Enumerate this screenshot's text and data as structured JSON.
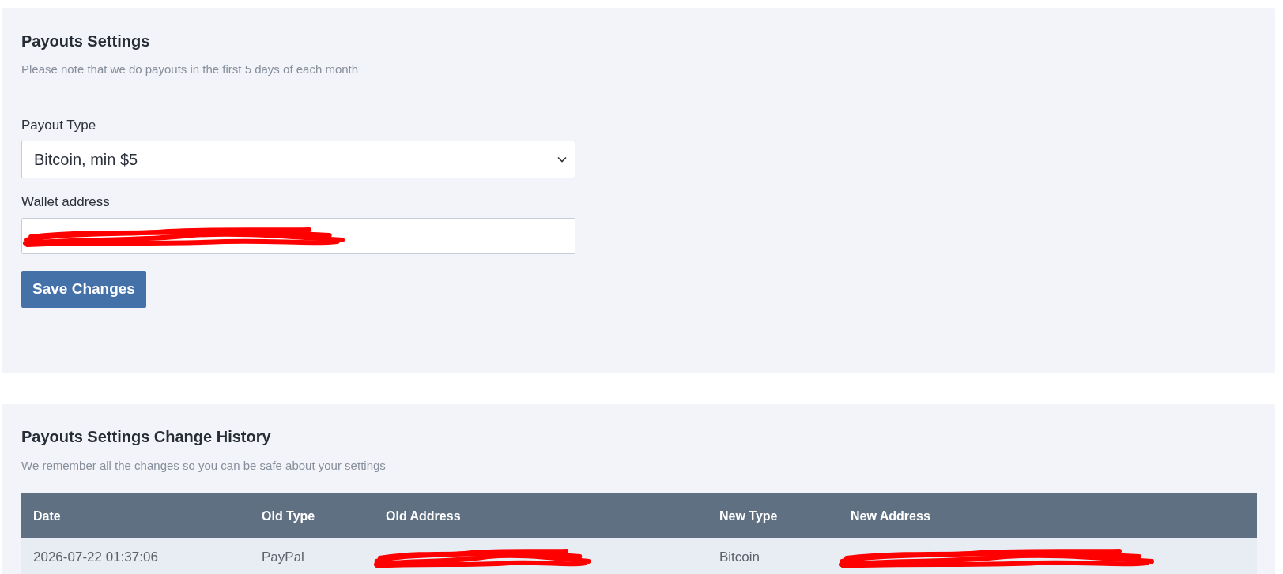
{
  "settings": {
    "title": "Payouts Settings",
    "subtitle": "Please note that we do payouts in the first 5 days of each month",
    "payout_type": {
      "label": "Payout Type",
      "value": "Bitcoin, min $5"
    },
    "wallet_address": {
      "label": "Wallet address",
      "redacted": true
    },
    "save_button": "Save Changes"
  },
  "history": {
    "title": "Payouts Settings Change History",
    "subtitle": "We remember all the changes so you can be safe about your settings",
    "table": {
      "columns": [
        "Date",
        "Old Type",
        "Old Address",
        "New Type",
        "New Address"
      ],
      "rows": [
        {
          "cells": [
            {
              "kind": "text",
              "text": "2026-07-22 01:37:06"
            },
            {
              "kind": "text",
              "text": "PayPal"
            },
            {
              "kind": "redacted"
            },
            {
              "kind": "text",
              "text": "Bitcoin"
            },
            {
              "kind": "redacted"
            }
          ]
        }
      ]
    }
  }
}
